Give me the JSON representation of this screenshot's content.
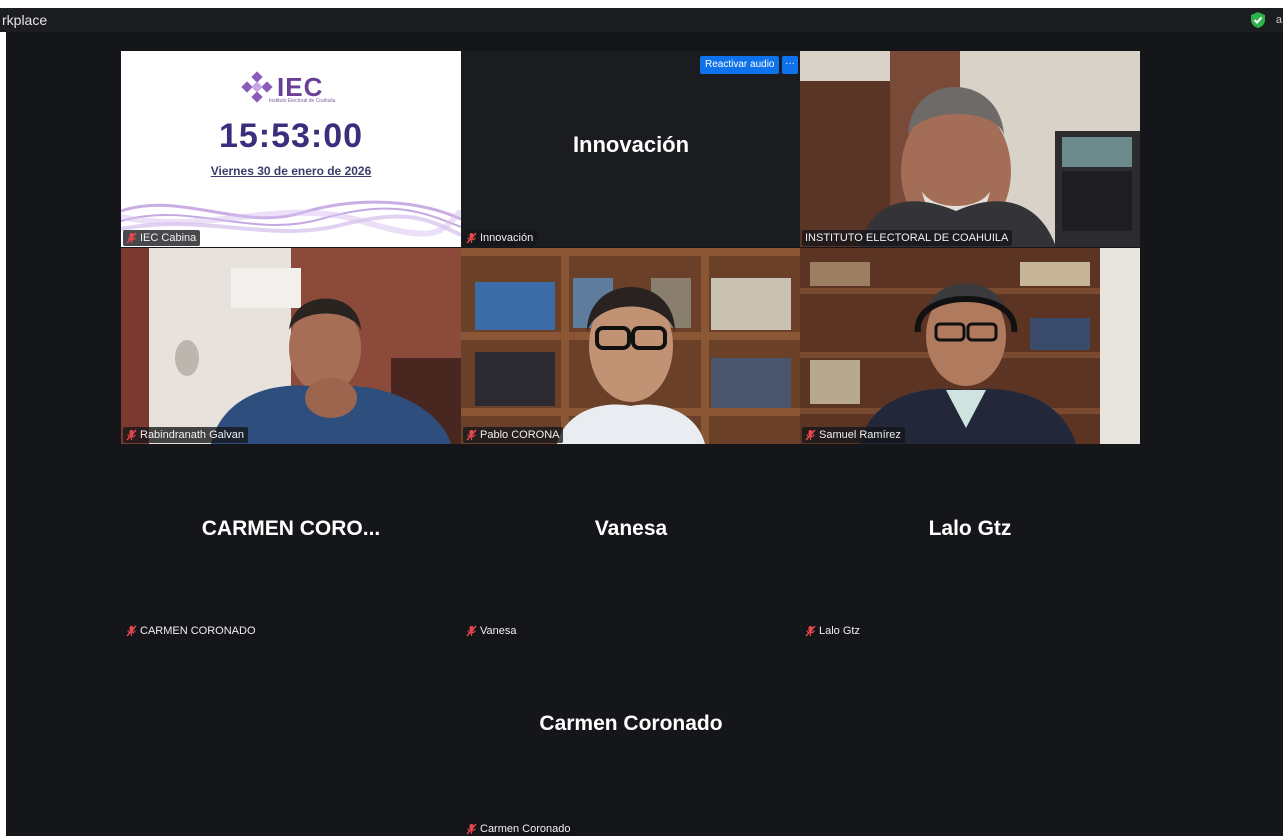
{
  "window": {
    "title": "rkplace",
    "cut_label": "a"
  },
  "controls": {
    "audio_button": "Reactivar audio",
    "more_button": "···"
  },
  "clock": {
    "logo_text": "IEC",
    "logo_subtitle": "Instituto Electoral de Coahuila",
    "time": "15:53:00",
    "date": "Viernes 30 de enero de 2026"
  },
  "tiles": {
    "iec_cabina": {
      "tag": "IEC Cabina"
    },
    "innovacion": {
      "display": "Innovación",
      "tag": "Innovación"
    },
    "instituto": {
      "tag": "INSTITUTO ELECTORAL DE COAHUILA"
    },
    "rabindranath": {
      "tag": "Rabindranath Galvan"
    },
    "pablo": {
      "tag": "Pablo CORONA"
    },
    "samuel": {
      "tag": "Samuel Ramírez"
    },
    "carmen_upper": {
      "display": "CARMEN CORO...",
      "tag": "CARMEN CORONADO"
    },
    "vanesa": {
      "display": "Vanesa",
      "tag": "Vanesa"
    },
    "lalo": {
      "display": "Lalo Gtz",
      "tag": "Lalo Gtz"
    },
    "carmen_lower": {
      "display": "Carmen Coronado",
      "tag": "Carmen Coronado"
    }
  },
  "colors": {
    "stage": "#141619",
    "speaking_border": "#2fd67a",
    "muted_icon": "#e5484d",
    "audio_button": "#0e72ed",
    "iec_purple": "#6a3f95"
  },
  "icons": [
    "shield-check-icon",
    "mic-muted-icon",
    "iec-logo-icon"
  ]
}
